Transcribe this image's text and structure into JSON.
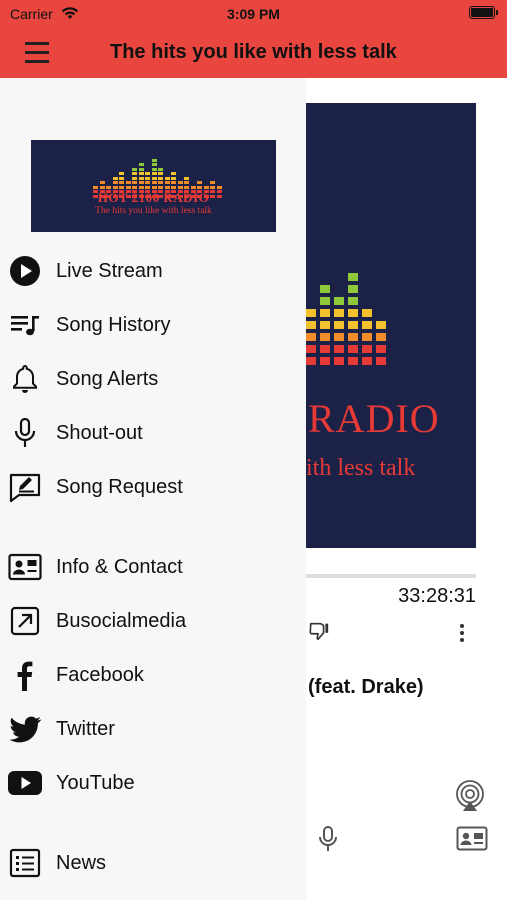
{
  "status_bar": {
    "carrier": "Carrier",
    "time": "3:09 PM"
  },
  "header": {
    "title": "The hits you like with less talk"
  },
  "colors": {
    "header_bg": "#e8463f",
    "logo_bg": "#1c2148",
    "logo_red": "#e53a35",
    "drawer_bg": "#f7f7f7"
  },
  "drawer": {
    "logo": {
      "title": "HOT 2100 RADIO",
      "subtitle": "The hits you like with less talk"
    },
    "items": [
      {
        "label": "Live Stream",
        "icon": "play-circle-icon"
      },
      {
        "label": "Song History",
        "icon": "playlist-icon"
      },
      {
        "label": "Song Alerts",
        "icon": "bell-icon"
      },
      {
        "label": "Shout-out",
        "icon": "microphone-icon"
      },
      {
        "label": "Song Request",
        "icon": "edit-square-icon"
      },
      {
        "label": "Info & Contact",
        "icon": "contact-card-icon"
      },
      {
        "label": "Busocialmedia",
        "icon": "external-link-icon"
      },
      {
        "label": "Facebook",
        "icon": "facebook-icon"
      },
      {
        "label": "Twitter",
        "icon": "twitter-icon"
      },
      {
        "label": "YouTube",
        "icon": "youtube-icon"
      },
      {
        "label": "News",
        "icon": "news-list-icon"
      }
    ]
  },
  "player": {
    "art_title": "RADIO",
    "art_subtitle": "ith less talk",
    "elapsed": "33:28:31",
    "track_title": "(feat. Drake)",
    "progress": 0.0
  }
}
